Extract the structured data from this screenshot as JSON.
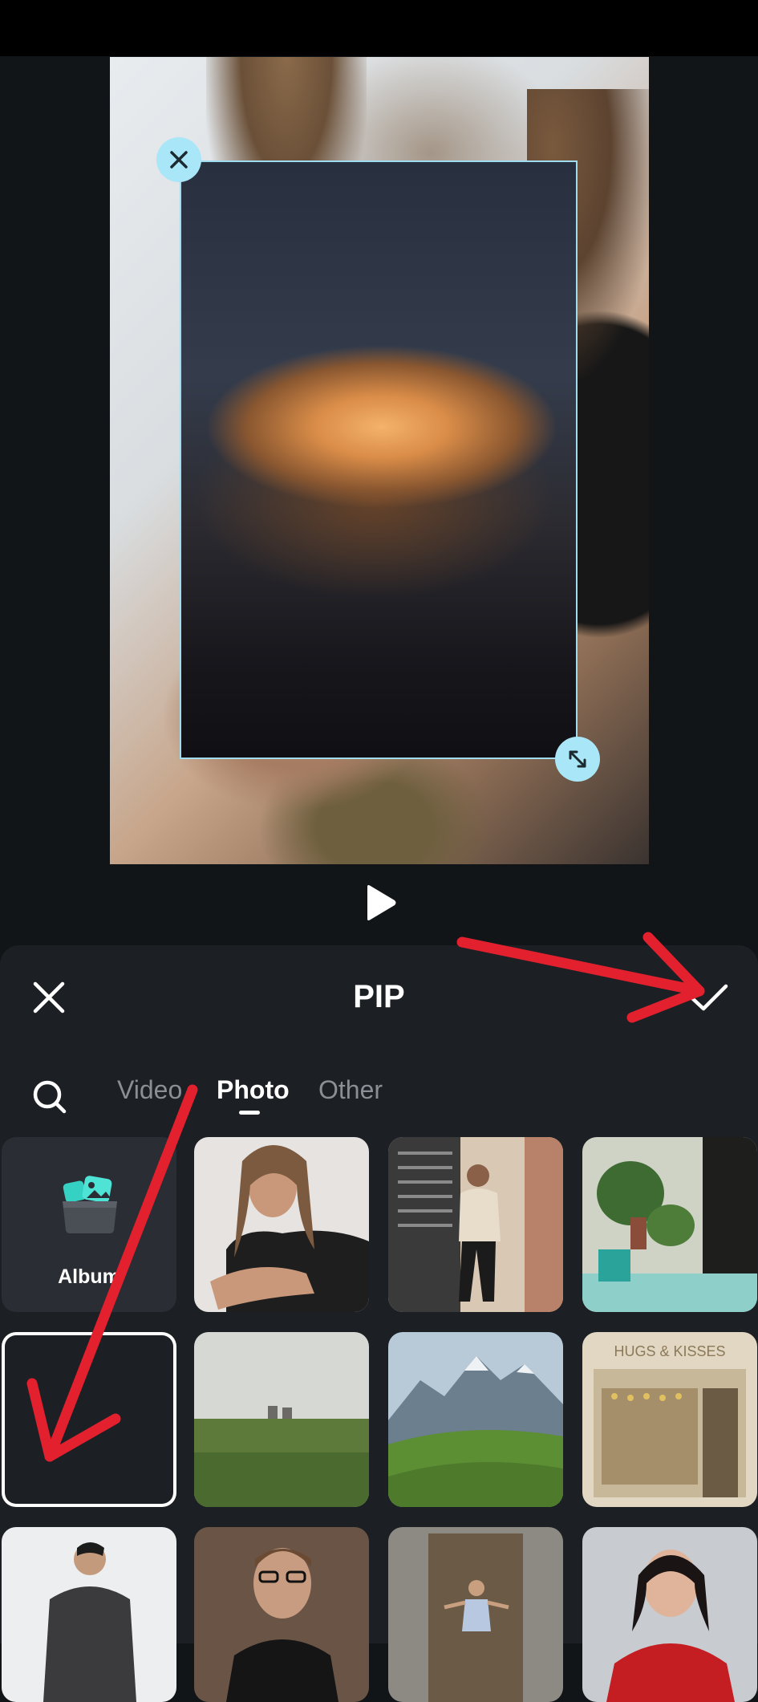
{
  "panel": {
    "title": "PIP"
  },
  "tabs": [
    {
      "label": "Video",
      "selected": false
    },
    {
      "label": "Photo",
      "selected": true
    },
    {
      "label": "Other",
      "selected": false
    }
  ],
  "album": {
    "label": "Album"
  },
  "thumbnails": [
    {
      "name": "woman-portrait-hair"
    },
    {
      "name": "man-leaning-doorway"
    },
    {
      "name": "plants-in-shop"
    },
    {
      "name": "orange-cloud-sky",
      "selected": true
    },
    {
      "name": "grass-field-house"
    },
    {
      "name": "green-mountains"
    },
    {
      "name": "hugs-kisses-storefront"
    },
    {
      "name": "man-jacket-grey"
    },
    {
      "name": "man-glasses-beard"
    },
    {
      "name": "woman-wooden-door"
    },
    {
      "name": "woman-red-jacket"
    }
  ],
  "storefront_sign": "HUGS & KISSES",
  "colors": {
    "background": "#121518",
    "panel": "#1c1f23",
    "handle_accent": "#a9e6f7",
    "annotation_arrow": "#e2202e"
  }
}
